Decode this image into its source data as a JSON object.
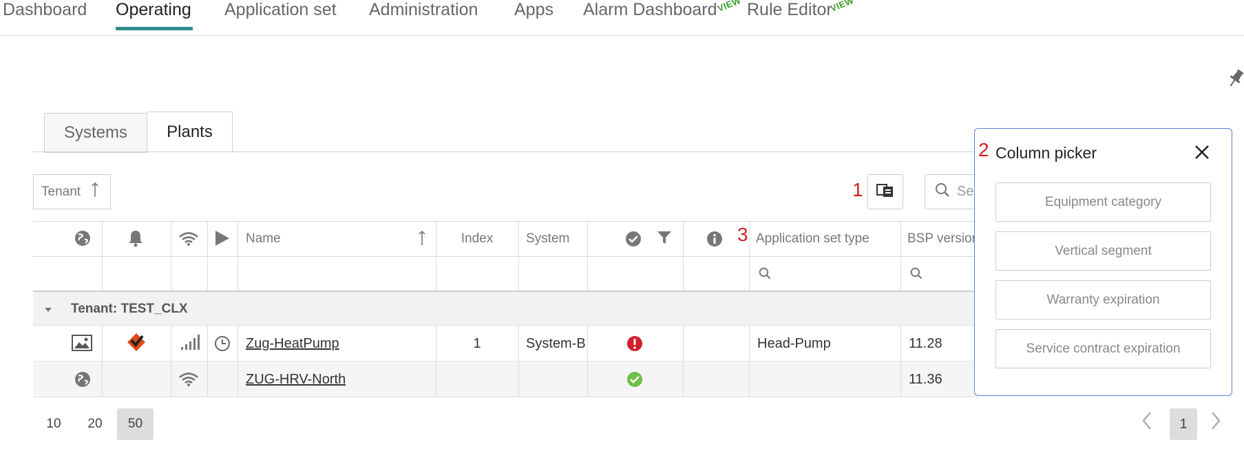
{
  "nav": {
    "items": [
      "Dashboard",
      "Operating",
      "Application set",
      "Administration",
      "Apps",
      "Alarm Dashboard",
      "Rule Editor"
    ],
    "preview_badge": "VIEW"
  },
  "tabs": [
    "Systems",
    "Plants"
  ],
  "sort": {
    "label": "Tenant"
  },
  "annotations": [
    "1",
    "2",
    "3"
  ],
  "search": {
    "placeholder": "Se"
  },
  "table": {
    "headers": {
      "name": "Name",
      "index": "Index",
      "system": "System",
      "app_set_type": "Application set type",
      "bsp_version": "BSP version"
    },
    "group": "Tenant: TEST_CLX",
    "rows": [
      {
        "name": "Zug-HeatPump",
        "index": "1",
        "system": "System-Bu",
        "app_set_type": "Head-Pump",
        "bsp_version": "11.28",
        "status": "error"
      },
      {
        "name": "ZUG-HRV-North",
        "index": "",
        "system": "",
        "app_set_type": "",
        "bsp_version": "11.36",
        "status": "ok"
      }
    ]
  },
  "pagination": {
    "page_sizes": [
      "10",
      "20",
      "50"
    ],
    "selected_size": "50",
    "current_page": "1"
  },
  "column_picker": {
    "title": "Column picker",
    "options": [
      "Equipment category",
      "Vertical segment",
      "Warranty expiration",
      "Service contract expiration"
    ]
  },
  "colors": {
    "accent": "#2f8c8c",
    "error": "#d0202e",
    "ok": "#6cc04a",
    "annotation": "#d21f1f",
    "panel_border": "#5a7fd3"
  }
}
